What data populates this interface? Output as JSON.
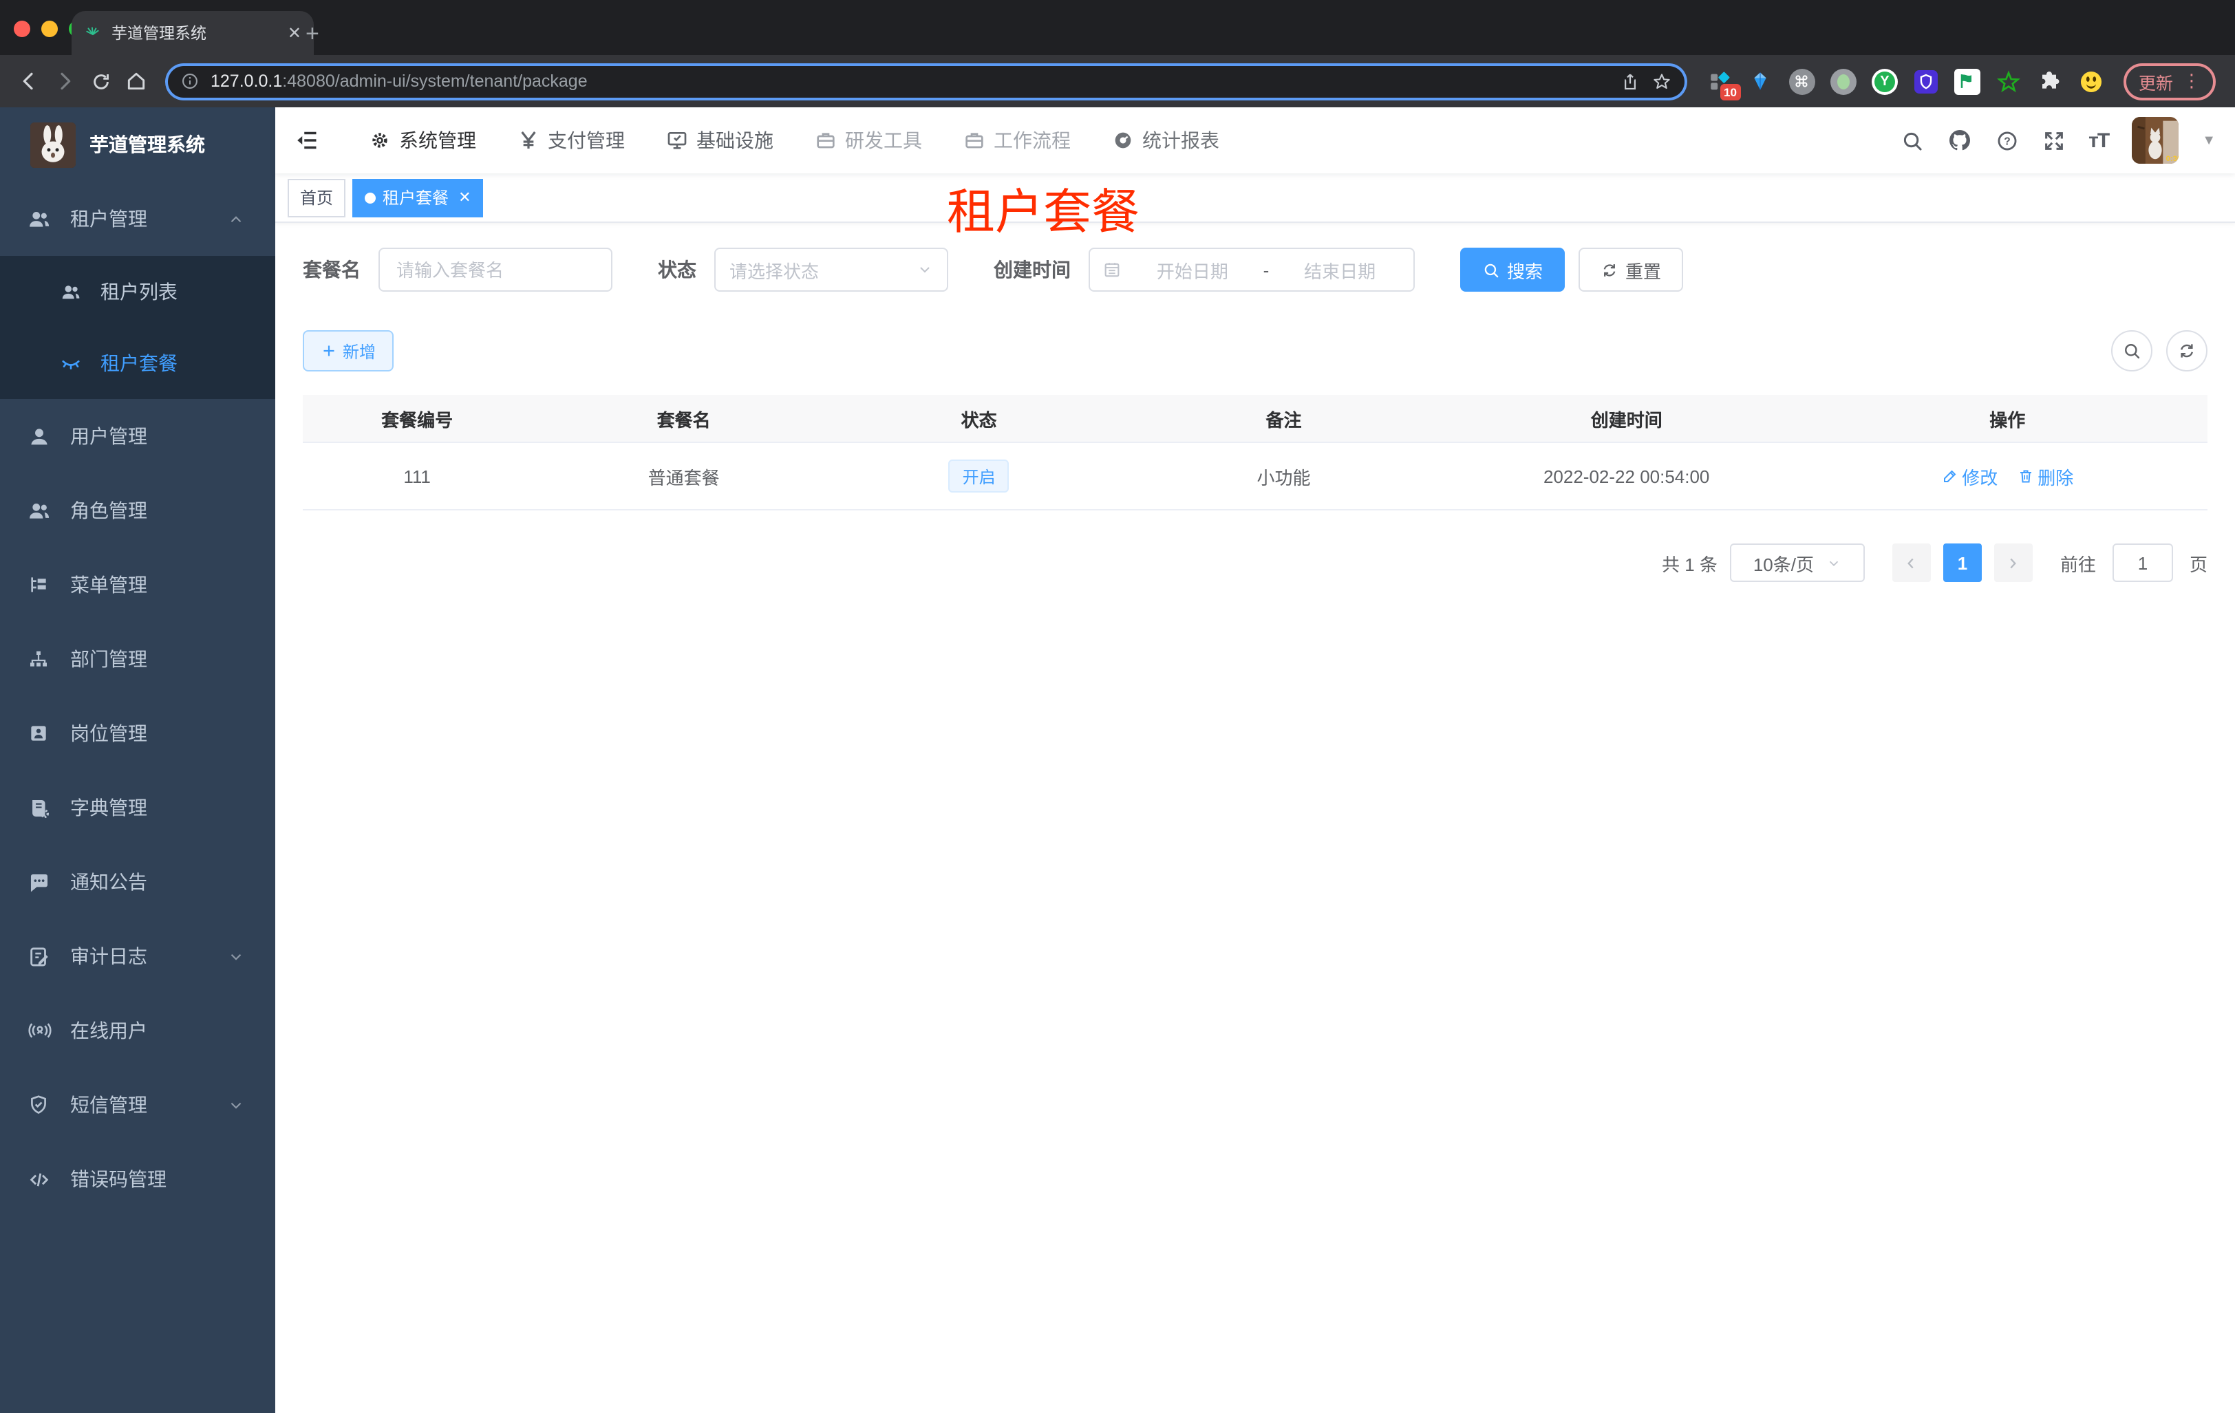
{
  "colors": {
    "primary": "#409eff",
    "annotation_red": "#ff2d00",
    "sidebar_bg": "#304156",
    "submenu_bg": "#1f2d3d"
  },
  "browser": {
    "tab_title": "芋道管理系统",
    "new_tab": "+",
    "url_host": "127.0.0.1",
    "url_rest": ":48080/admin-ui/system/tenant/package",
    "ext_badge": "10",
    "update_label": "更新"
  },
  "header": {
    "nav": [
      {
        "label": "系统管理"
      },
      {
        "label": "支付管理"
      },
      {
        "label": "基础设施"
      },
      {
        "label": "研发工具"
      },
      {
        "label": "工作流程"
      },
      {
        "label": "统计报表"
      }
    ]
  },
  "sidebar": {
    "title": "芋道管理系统",
    "items": [
      {
        "label": "租户管理"
      },
      {
        "label": "租户列表"
      },
      {
        "label": "租户套餐"
      },
      {
        "label": "用户管理"
      },
      {
        "label": "角色管理"
      },
      {
        "label": "菜单管理"
      },
      {
        "label": "部门管理"
      },
      {
        "label": "岗位管理"
      },
      {
        "label": "字典管理"
      },
      {
        "label": "通知公告"
      },
      {
        "label": "审计日志"
      },
      {
        "label": "在线用户"
      },
      {
        "label": "短信管理"
      },
      {
        "label": "错误码管理"
      }
    ]
  },
  "tags": {
    "home": "首页",
    "active": "租户套餐"
  },
  "annotation": "租户套餐",
  "filters": {
    "name_label": "套餐名",
    "name_placeholder": "请输入套餐名",
    "status_label": "状态",
    "status_placeholder": "请选择状态",
    "date_label": "创建时间",
    "date_start": "开始日期",
    "date_sep": "-",
    "date_end": "结束日期",
    "search": "搜索",
    "reset": "重置"
  },
  "toolbar": {
    "add": "新增"
  },
  "table": {
    "headers": [
      "套餐编号",
      "套餐名",
      "状态",
      "备注",
      "创建时间",
      "操作"
    ],
    "rows": [
      {
        "id": "111",
        "name": "普通套餐",
        "status": "开启",
        "remark": "小功能",
        "created": "2022-02-22 00:54:00",
        "edit": "修改",
        "delete": "删除"
      }
    ]
  },
  "pagination": {
    "total": "共 1 条",
    "size": "10条/页",
    "page": "1",
    "goto": "前往",
    "unit": "页",
    "goto_value": "1"
  }
}
